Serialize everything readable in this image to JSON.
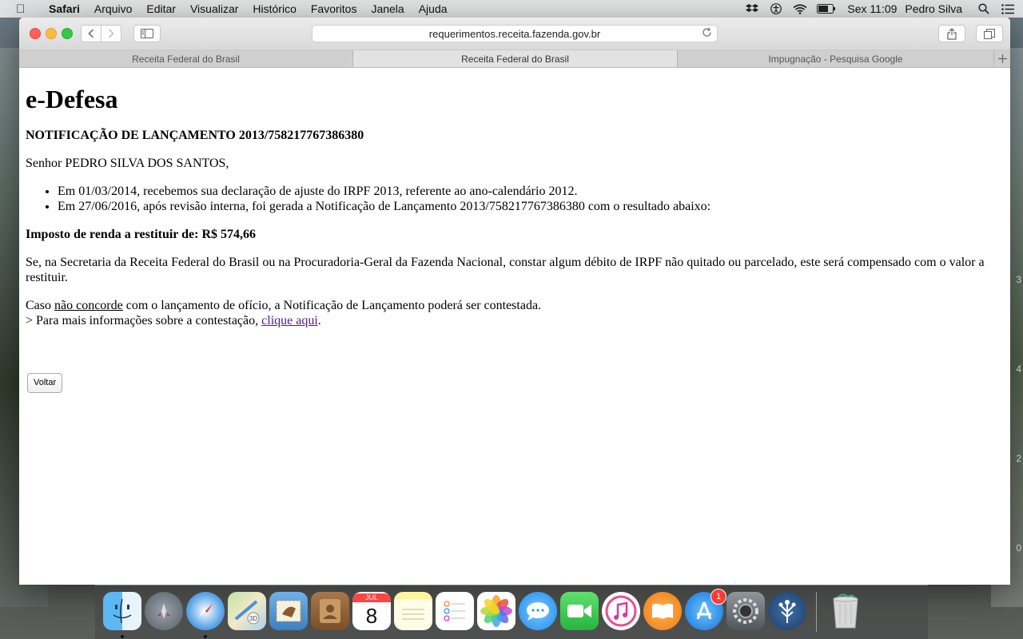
{
  "menubar": {
    "app": "Safari",
    "items": [
      "Arquivo",
      "Editar",
      "Visualizar",
      "Histórico",
      "Favoritos",
      "Janela",
      "Ajuda"
    ],
    "clock": "Sex 11:09",
    "user": "Pedro Silva"
  },
  "browser": {
    "url": "requerimentos.receita.fazenda.gov.br",
    "tabs": [
      "Receita Federal do Brasil",
      "Receita Federal do Brasil",
      "Impugnação - Pesquisa Google"
    ]
  },
  "page": {
    "title": "e-Defesa",
    "notice": "NOTIFICAÇÃO DE LANÇAMENTO 2013/758217767386380",
    "greeting": "Senhor PEDRO SILVA DOS SANTOS,",
    "bullets": [
      "Em 01/03/2014, recebemos sua declaração de ajuste do IRPF 2013, referente ao ano-calendário 2012.",
      "Em 27/06/2016, após revisão interna, foi gerada a Notificação de Lançamento 2013/758217767386380 com o resultado abaixo:"
    ],
    "refund": "Imposto de renda a restituir de: R$ 574,66",
    "compensation": "Se, na Secretaria da Receita Federal do Brasil ou na Procuradoria-Geral da Fazenda Nacional, constar algum débito de IRPF não quitado ou parcelado, este será compensado com o valor a restituir.",
    "case_prefix": "Caso ",
    "case_link": "não concorde",
    "case_suffix": " com o lançamento de ofício, a Notificação de Lançamento poderá ser contestada.",
    "info_prefix": "> Para mais informações sobre a contestação, ",
    "info_link": "clique aqui",
    "info_suffix": ".",
    "back_button": "Voltar"
  },
  "desktop_numbers": [
    "3",
    "4",
    "2",
    "0"
  ],
  "dock": {
    "apps": [
      "finder-icon",
      "launchpad-icon",
      "safari-icon",
      "maps-icon",
      "mail-icon",
      "contacts-icon",
      "calendar-icon",
      "notes-icon",
      "reminders-icon",
      "photos-icon",
      "messages-icon",
      "facetime-icon",
      "itunes-icon",
      "ibooks-icon",
      "app-store-icon",
      "system-preferences-icon",
      "sourcetree-icon",
      "trash-icon"
    ],
    "calendar_month": "JUL",
    "calendar_day": "8",
    "appstore_badge": "1"
  }
}
